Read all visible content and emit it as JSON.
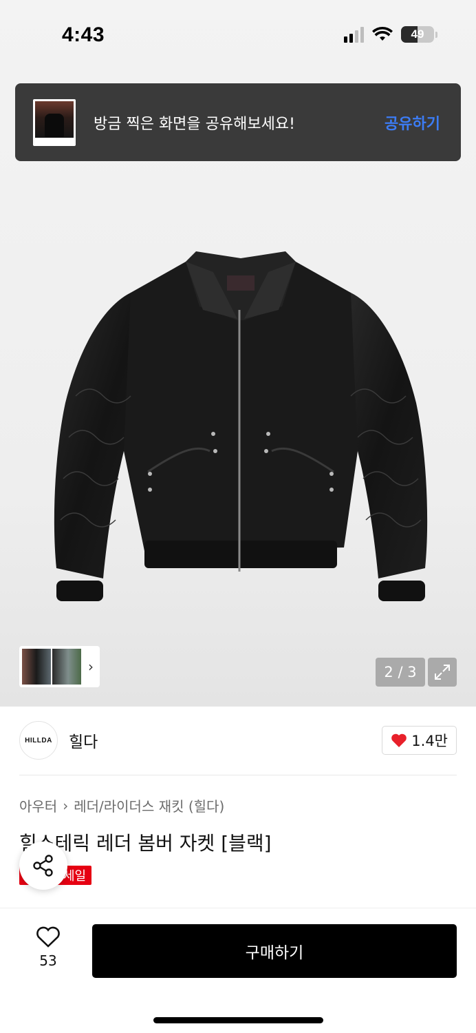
{
  "status_bar": {
    "time": "4:43",
    "battery": "49",
    "battery_level": 0.49
  },
  "toast": {
    "message": "방금 찍은 화면을 공유해보세요!",
    "action_label": "공유하기"
  },
  "gallery": {
    "counter": "2 / 3",
    "thumbnail_chevron": "›",
    "icons": [
      "expand-icon",
      "chevron-right-icon"
    ]
  },
  "brand": {
    "logo_text": "HILLDA",
    "name": "힐다",
    "likes": "1.4만",
    "accent_color": "#e8202a"
  },
  "product": {
    "breadcrumb": [
      "아우터",
      "레더/라이더스 재킷 (힐다)"
    ],
    "breadcrumb_separator": "›",
    "title": "힐스테릭 레더 봄버 자켓 [블랙]",
    "badge": "세일",
    "badge_color": "#e60012"
  },
  "bottom_bar": {
    "wishlist_count": "53",
    "buy_label": "구매하기"
  }
}
